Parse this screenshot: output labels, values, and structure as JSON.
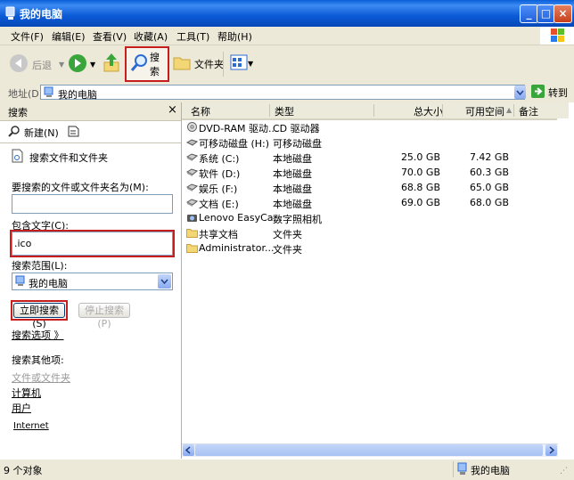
{
  "window": {
    "title": "我的电脑"
  },
  "menu": [
    "文件(F)",
    "编辑(E)",
    "查看(V)",
    "收藏(A)",
    "工具(T)",
    "帮助(H)"
  ],
  "toolbar": {
    "back": "后退",
    "search": "搜索",
    "folders": "文件夹"
  },
  "address": {
    "label": "地址(D)",
    "value": "我的电脑",
    "go": "转到"
  },
  "left": {
    "header": "搜索",
    "close": "×",
    "new_btn": "新建(N)",
    "search_files_title": "搜索文件和文件夹",
    "name_label": "要搜索的文件或文件夹名为(M):",
    "name_value": "",
    "contains_label": "包含文字(C):",
    "contains_value": ".ico",
    "scope_label": "搜索范围(L):",
    "scope_value": "我的电脑",
    "search_now": "立即搜索(S)",
    "stop_search": "停止搜索(P)",
    "options": "搜索选项 》",
    "other_items_title": "搜索其他项:",
    "other_items": [
      "文件或文件夹",
      "计算机",
      "用户"
    ],
    "internet": "Internet"
  },
  "columns": [
    "名称",
    "类型",
    "总大小",
    "可用空间",
    "备注"
  ],
  "rows": [
    {
      "name": "DVD-RAM 驱动...",
      "type": "CD 驱动器",
      "total": "",
      "free": "",
      "icon": "cd-drive-icon"
    },
    {
      "name": "可移动磁盘 (H:)",
      "type": "可移动磁盘",
      "total": "",
      "free": "",
      "icon": "removable-disk-icon"
    },
    {
      "name": "系统 (C:)",
      "type": "本地磁盘",
      "total": "25.0 GB",
      "free": "7.42 GB",
      "icon": "hard-disk-icon"
    },
    {
      "name": "软件 (D:)",
      "type": "本地磁盘",
      "total": "70.0 GB",
      "free": "60.3 GB",
      "icon": "hard-disk-icon"
    },
    {
      "name": "娱乐 (F:)",
      "type": "本地磁盘",
      "total": "68.8 GB",
      "free": "65.0 GB",
      "icon": "hard-disk-icon"
    },
    {
      "name": "文档 (E:)",
      "type": "本地磁盘",
      "total": "69.0 GB",
      "free": "68.0 GB",
      "icon": "hard-disk-icon"
    },
    {
      "name": "Lenovo EasyCa...",
      "type": "数字照相机",
      "total": "",
      "free": "",
      "icon": "camera-icon"
    },
    {
      "name": "共享文档",
      "type": "文件夹",
      "total": "",
      "free": "",
      "icon": "folder-icon"
    },
    {
      "name": "Administrator...",
      "type": "文件夹",
      "total": "",
      "free": "",
      "icon": "folder-icon"
    }
  ],
  "status": {
    "count": "9 个对象",
    "location": "我的电脑"
  }
}
